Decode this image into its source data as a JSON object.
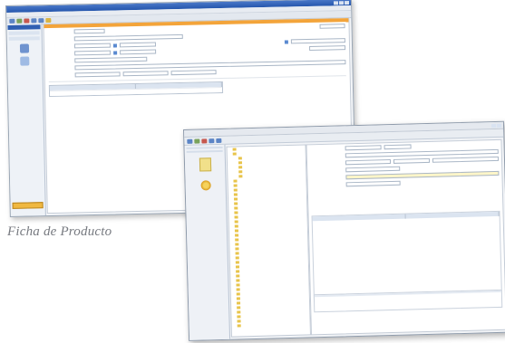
{
  "caption": "Ficha de Producto",
  "colors": {
    "accent_blue": "#2556ad",
    "orange_bar": "#f3a43a",
    "selection": "#2f62c1",
    "folder": "#f1e08a"
  },
  "window1": {
    "title": "",
    "menu": [
      "",
      "",
      "",
      ""
    ],
    "form_rows": [
      {
        "label": "",
        "value": ""
      },
      {
        "label": "",
        "value": ""
      },
      {
        "label": "",
        "value": ""
      },
      {
        "label": "",
        "value": ""
      },
      {
        "label": "",
        "value": ""
      },
      {
        "label": "",
        "value": ""
      },
      {
        "label": "",
        "value": ""
      }
    ],
    "grid": {
      "columns": [
        "",
        ""
      ],
      "rows": [
        [
          "",
          ""
        ]
      ]
    }
  },
  "window2": {
    "title": "",
    "left_tabs": [
      "",
      ""
    ],
    "tree_nodes_count_visible": 40,
    "detail_fields": [
      {
        "label": "",
        "value": ""
      },
      {
        "label": "",
        "value": ""
      },
      {
        "label": "",
        "value": ""
      },
      {
        "label": "",
        "value": ""
      },
      {
        "label": "",
        "value": ""
      },
      {
        "label": "",
        "value": ""
      }
    ]
  }
}
